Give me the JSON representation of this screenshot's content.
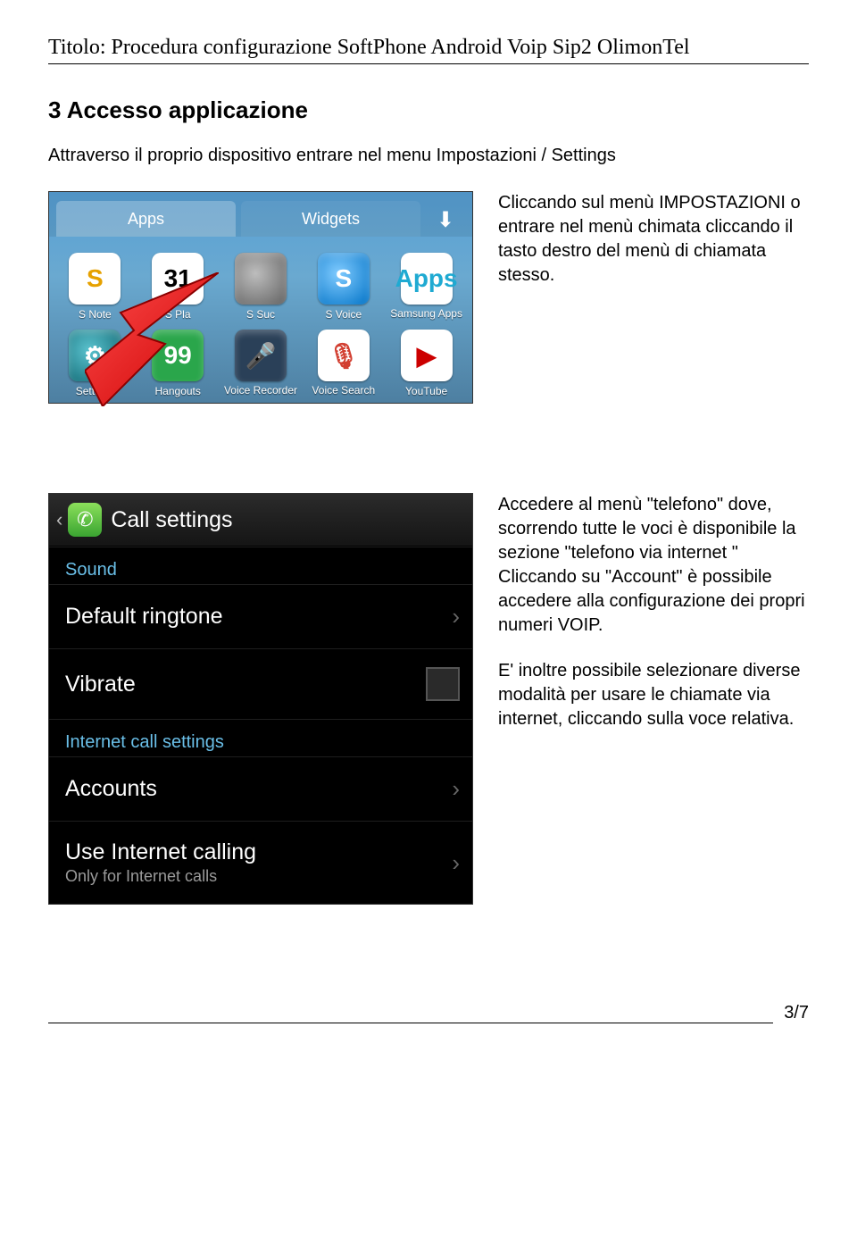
{
  "doc": {
    "title_label": "Titolo: Procedura configurazione SoftPhone Android  Voip Sip2 OlimonTel",
    "section_heading": "3 Accesso applicazione",
    "intro": "Attraverso il proprio dispositivo entrare nel menu Impostazioni / Settings",
    "para1": "Cliccando sul menù IMPOSTAZIONI o entrare nel menù chimata cliccando il tasto destro del menù di chiamata stesso.",
    "para2": "Accedere al  menù \"telefono\" dove, scorrendo tutte le voci è disponibile la sezione \"telefono via internet \" Cliccando su \"Account\" è possibile accedere alla configurazione dei propri numeri VOIP.",
    "para3": "E' inoltre possibile selezionare diverse modalità per usare le chiamate via internet, cliccando sulla voce relativa.",
    "page_number": "3/7"
  },
  "launcher": {
    "tab_apps": "Apps",
    "tab_widgets": "Widgets",
    "apps": [
      {
        "label": "S Note",
        "icon": "S"
      },
      {
        "label": "S Pla",
        "icon": "31"
      },
      {
        "label": "S Suc",
        "icon": ""
      },
      {
        "label": "S Voice",
        "icon": "S"
      },
      {
        "label": "Samsung\nApps",
        "icon": "Apps"
      },
      {
        "label": "Settings",
        "icon": "⚙"
      },
      {
        "label": "Hangouts",
        "icon": "99"
      },
      {
        "label": "Voice\nRecorder",
        "icon": "🎤"
      },
      {
        "label": "Voice\nSearch",
        "icon": "🎙"
      },
      {
        "label": "YouTube",
        "icon": "▶"
      }
    ]
  },
  "callsettings": {
    "title": "Call settings",
    "groups": [
      {
        "name": "Sound",
        "items": [
          {
            "primary": "Default ringtone",
            "type": "nav"
          },
          {
            "primary": "Vibrate",
            "type": "check"
          }
        ]
      },
      {
        "name": "Internet call settings",
        "items": [
          {
            "primary": "Accounts",
            "type": "nav"
          },
          {
            "primary": "Use Internet calling",
            "secondary": "Only for Internet calls",
            "type": "nav"
          }
        ]
      }
    ]
  }
}
